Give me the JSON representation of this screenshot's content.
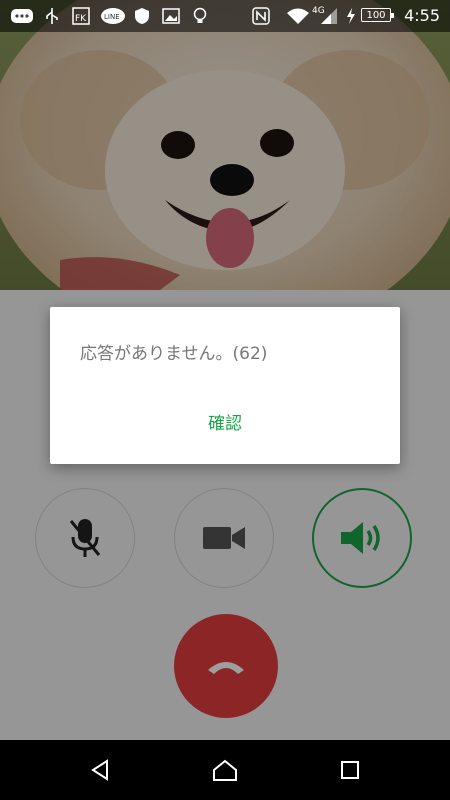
{
  "status_bar": {
    "time": "4:55",
    "battery": "100",
    "network": "4G",
    "icons": [
      "chat-icon",
      "usb-icon",
      "fk-icon",
      "line-icon",
      "shield-icon",
      "image-icon",
      "bulb-icon",
      "nfc-icon",
      "wifi-icon",
      "signal-icon",
      "charging-icon"
    ]
  },
  "call": {
    "photo": "pomeranian-dog-photo",
    "controls": {
      "mute": {
        "icon": "mic-off-icon"
      },
      "video": {
        "icon": "video-camera-icon"
      },
      "speaker": {
        "icon": "speaker-icon",
        "active": true
      },
      "end_call": {
        "icon": "hangup-icon"
      }
    }
  },
  "dialog": {
    "message": "応答がありません。(62)",
    "confirm_label": "確認"
  },
  "colors": {
    "accent": "#1aa34a",
    "end_call": "#e33c3c"
  },
  "nav": {
    "buttons": [
      "back-icon",
      "home-icon",
      "recents-icon"
    ]
  }
}
